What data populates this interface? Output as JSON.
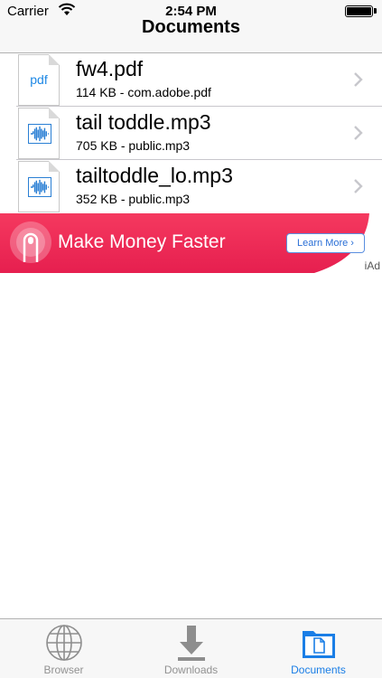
{
  "status_bar": {
    "carrier": "Carrier",
    "time": "2:54 PM"
  },
  "nav_bar": {
    "title": "Documents"
  },
  "documents": [
    {
      "name": "fw4.pdf",
      "meta": "114 KB - com.adobe.pdf",
      "icon": "pdf-file-icon",
      "icon_label": "pdf"
    },
    {
      "name": "tail toddle.mp3",
      "meta": "705 KB - public.mp3",
      "icon": "audio-file-icon"
    },
    {
      "name": "tailtoddle_lo.mp3",
      "meta": "352 KB - public.mp3",
      "icon": "audio-file-icon"
    }
  ],
  "ad": {
    "text": "Make Money Faster",
    "button": "Learn More ›",
    "brand": "iAd",
    "color": "#f2285a"
  },
  "tab_bar": {
    "items": [
      {
        "label": "Browser",
        "icon": "globe-icon",
        "active": false
      },
      {
        "label": "Downloads",
        "icon": "download-arrow-icon",
        "active": false
      },
      {
        "label": "Documents",
        "icon": "folder-icon",
        "active": true
      }
    ],
    "active_color": "#1a7ee6",
    "inactive_color": "#929292"
  }
}
